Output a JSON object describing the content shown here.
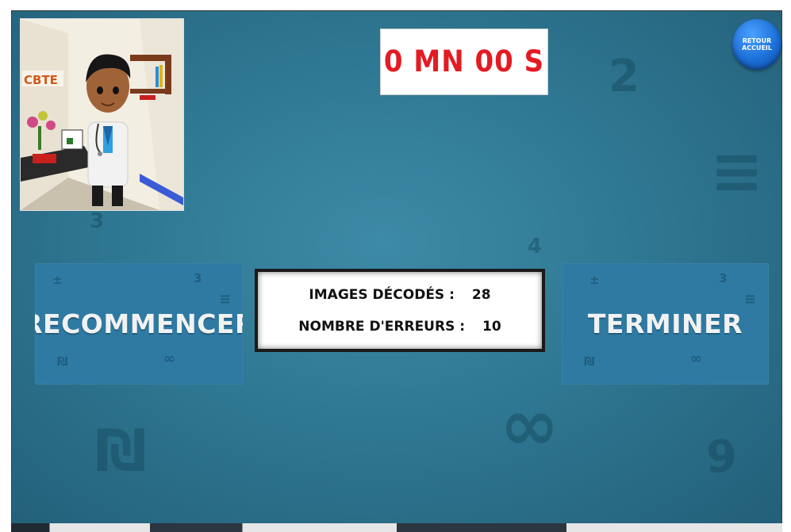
{
  "timer": {
    "text": "0 MN 00 S"
  },
  "home_button": {
    "line1": "RETOUR",
    "line2": "ACCUEIL"
  },
  "avatar": {
    "sign_text": "CBTE"
  },
  "restart_button": {
    "label": "RECOMMENCER"
  },
  "finish_button": {
    "label": "TERMINER"
  },
  "stats": {
    "decoded_label": "IMAGES DÉCODÉS :",
    "decoded_value": "28",
    "errors_label": "NOMBRE D'ERREURS :",
    "errors_value": "10"
  },
  "colors": {
    "background": "#2f7893",
    "timer_text": "#e31b23",
    "button_fill": "#2e7aa3",
    "home_button": "#1c6fd8"
  }
}
